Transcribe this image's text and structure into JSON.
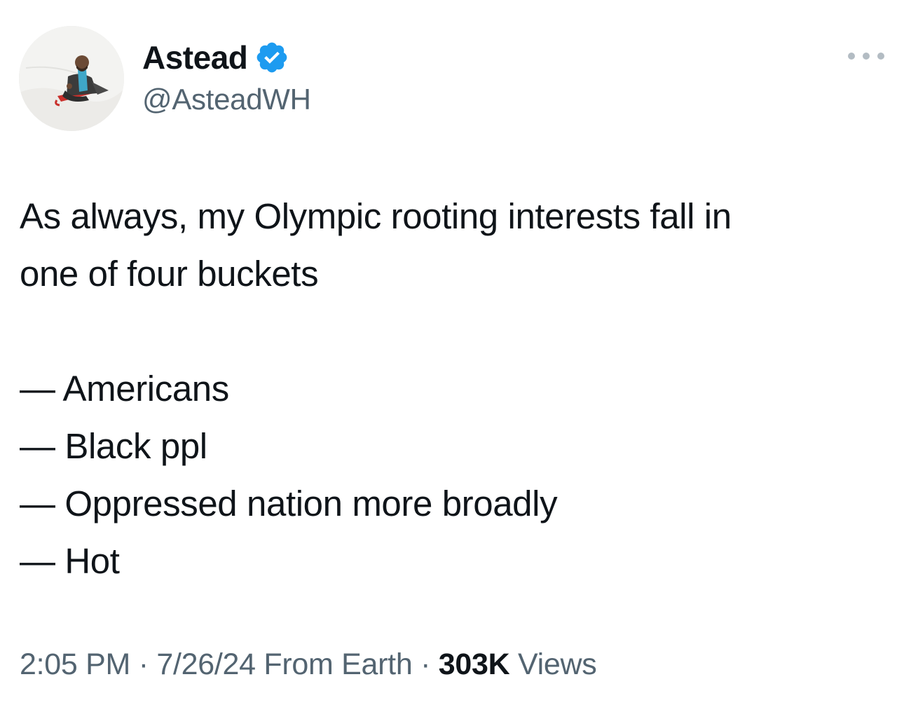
{
  "author": {
    "display_name": "Astead",
    "handle": "@AsteadWH",
    "verified_color": "#1d9bf0"
  },
  "tweet": {
    "lines": [
      "As always, my Olympic rooting interests fall in",
      "one of four buckets"
    ],
    "list_items": [
      "— Americans",
      "— Black ppl",
      "— Oppressed nation more broadly",
      "— Hot"
    ]
  },
  "meta": {
    "time": "2:05 PM",
    "separator": " · ",
    "date": "7/26/24",
    "source": "From Earth",
    "views_count": "303K",
    "views_label": "Views"
  },
  "icons": {
    "verified": "verified-badge-icon",
    "more": "more-options-icon"
  }
}
